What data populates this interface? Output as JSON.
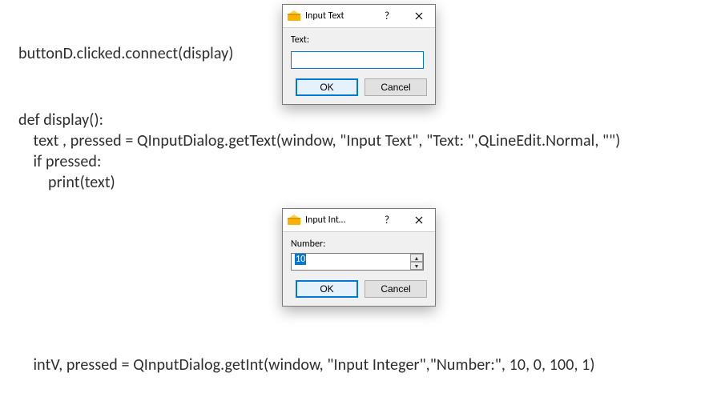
{
  "code": {
    "l1": "buttonD.clicked.connect(display)",
    "l2": "def display():",
    "l3": "    text , pressed = QInputDialog.getText(window, \"Input Text\", \"Text: \",QLineEdit.Normal, \"\")",
    "l4": "    if pressed:",
    "l5": "        print(text)",
    "l6": "    intV, pressed = QInputDialog.getInt(window, \"Input Integer\",\"Number:\", 10, 0, 100, 1)"
  },
  "dialog_text": {
    "title": "Input Text",
    "help": "?",
    "label": "Text:",
    "value": "",
    "ok": "OK",
    "cancel": "Cancel"
  },
  "dialog_int": {
    "title": "Input Int…",
    "help": "?",
    "label": "Number:",
    "value": "10",
    "ok": "OK",
    "cancel": "Cancel"
  }
}
